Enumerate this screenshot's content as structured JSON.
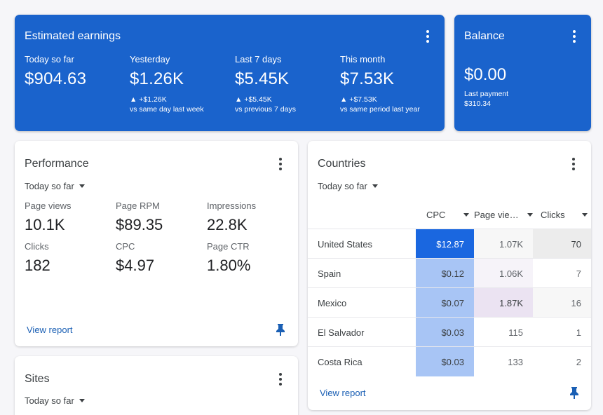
{
  "earnings": {
    "title": "Estimated earnings",
    "metrics": [
      {
        "label": "Today so far",
        "value": "$904.63",
        "change": "",
        "compare": ""
      },
      {
        "label": "Yesterday",
        "value": "$1.26K",
        "change": "▲ +$1.26K",
        "compare": "vs same day last week"
      },
      {
        "label": "Last 7 days",
        "value": "$5.45K",
        "change": "▲ +$5.45K",
        "compare": "vs previous 7 days"
      },
      {
        "label": "This month",
        "value": "$7.53K",
        "change": "▲ +$7.53K",
        "compare": "vs same period last year"
      }
    ]
  },
  "balance": {
    "title": "Balance",
    "value": "$0.00",
    "last_payment_label": "Last payment",
    "last_payment_value": "$310.34"
  },
  "performance": {
    "title": "Performance",
    "period": "Today so far",
    "metrics": [
      {
        "label": "Page views",
        "value": "10.1K"
      },
      {
        "label": "Page RPM",
        "value": "$89.35"
      },
      {
        "label": "Impressions",
        "value": "22.8K"
      },
      {
        "label": "Clicks",
        "value": "182"
      },
      {
        "label": "CPC",
        "value": "$4.97"
      },
      {
        "label": "Page CTR",
        "value": "1.80%"
      }
    ],
    "view_report": "View report"
  },
  "sites": {
    "title": "Sites",
    "period": "Today so far"
  },
  "countries": {
    "title": "Countries",
    "period": "Today so far",
    "columns": [
      "CPC",
      "Page vie…",
      "Clicks"
    ],
    "rows": [
      {
        "country": "United States",
        "cpc": "$12.87",
        "page_views": "1.07K",
        "clicks": "70"
      },
      {
        "country": "Spain",
        "cpc": "$0.12",
        "page_views": "1.06K",
        "clicks": "7"
      },
      {
        "country": "Mexico",
        "cpc": "$0.07",
        "page_views": "1.87K",
        "clicks": "16"
      },
      {
        "country": "El Salvador",
        "cpc": "$0.03",
        "page_views": "115",
        "clicks": "1"
      },
      {
        "country": "Costa Rica",
        "cpc": "$0.03",
        "page_views": "133",
        "clicks": "2"
      }
    ],
    "view_report": "View report"
  },
  "colors": {
    "header_blue": "#1a63cc",
    "heat_strong": "#1a67e0",
    "heat_light": "#a8c5f5",
    "heat_purple": "#ebe3f2",
    "heat_gray": "#efefef",
    "link": "#1a5fb4"
  },
  "icons": [
    "more-vert-icon",
    "caret-down-icon",
    "pin-icon"
  ]
}
